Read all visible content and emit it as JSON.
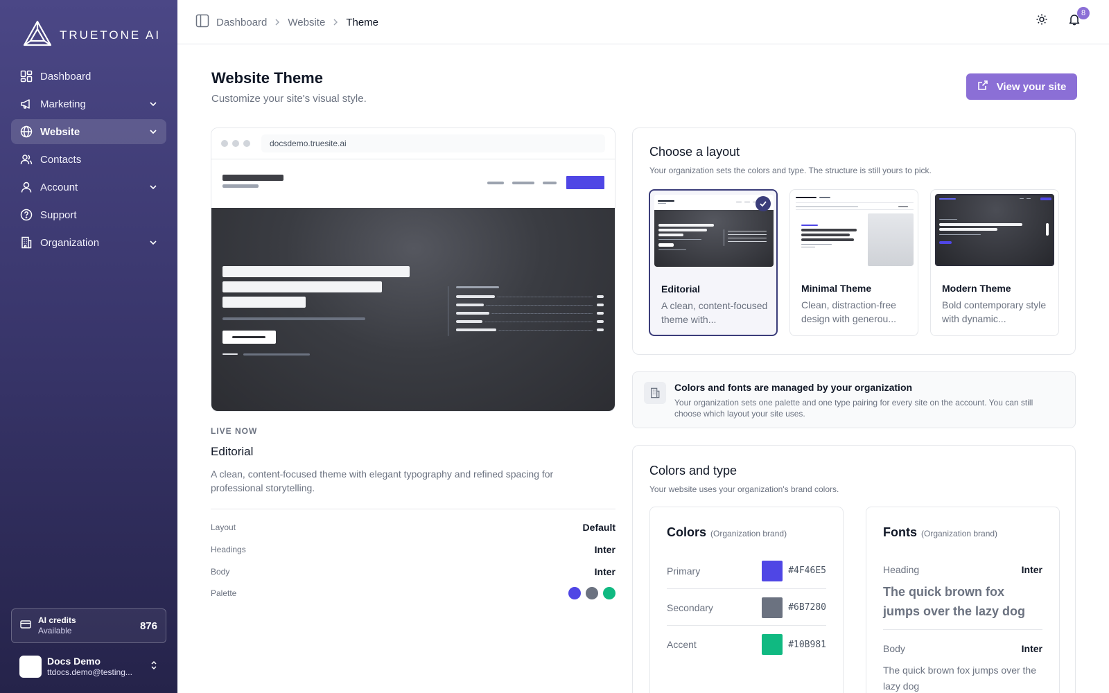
{
  "brand": {
    "name": "TRUETONE AI"
  },
  "sidebar": {
    "items": [
      {
        "label": "Dashboard",
        "icon": "grid-icon"
      },
      {
        "label": "Marketing",
        "icon": "megaphone-icon"
      },
      {
        "label": "Website",
        "icon": "globe-icon"
      },
      {
        "label": "Contacts",
        "icon": "users-icon"
      },
      {
        "label": "Account",
        "icon": "user-icon"
      },
      {
        "label": "Support",
        "icon": "help-circle-icon"
      },
      {
        "label": "Organization",
        "icon": "building-icon"
      }
    ],
    "credits": {
      "title": "AI credits",
      "status": "Available",
      "amount": "876"
    },
    "user": {
      "name": "Docs Demo",
      "email": "ttdocs.demo@testing..."
    }
  },
  "topbar": {
    "breadcrumbs": [
      "Dashboard",
      "Website",
      "Theme"
    ],
    "notifications_count": "8"
  },
  "header": {
    "title": "Website Theme",
    "subtitle": "Customize your site's visual style.",
    "view_site_label": "View your site"
  },
  "preview": {
    "url": "docsdemo.truesite.ai",
    "live_label": "LIVE NOW",
    "theme_name": "Editorial",
    "theme_description": "A clean, content-focused theme with elegant typography and refined spacing for professional storytelling.",
    "specs": [
      {
        "label": "Layout",
        "value": "Default"
      },
      {
        "label": "Headings",
        "value": "Inter"
      },
      {
        "label": "Body",
        "value": "Inter"
      },
      {
        "label": "Palette",
        "value": ""
      }
    ]
  },
  "layout_panel": {
    "title": "Choose a layout",
    "subtitle": "Your organization sets the colors and type. The structure is still yours to pick.",
    "cards": [
      {
        "title": "Editorial",
        "desc": "A clean, content-focused theme with...",
        "selected": true
      },
      {
        "title": "Minimal Theme",
        "desc": "Clean, distraction-free design with generou...",
        "selected": false
      },
      {
        "title": "Modern Theme",
        "desc": "Bold contemporary style with dynamic...",
        "selected": false
      }
    ]
  },
  "notice": {
    "title": "Colors and fonts are managed by your organization",
    "desc": "Your organization sets one palette and one type pairing for every site on the account. You can still choose which layout your site uses."
  },
  "colors_panel": {
    "title": "Colors and type",
    "subtitle": "Your website uses your organization's brand colors.",
    "colors_title": "Colors",
    "colors_note": "(Organization brand)",
    "colors": [
      {
        "label": "Primary",
        "hex": "#4F46E5"
      },
      {
        "label": "Secondary",
        "hex": "#6B7280"
      },
      {
        "label": "Accent",
        "hex": "#10B981"
      }
    ],
    "fonts_title": "Fonts",
    "fonts_note": "(Organization brand)",
    "heading_label": "Heading",
    "heading_font": "Inter",
    "heading_sample": "The quick brown fox jumps over the lazy dog",
    "body_label": "Body",
    "body_font": "Inter",
    "body_sample": "The quick brown fox jumps over the lazy dog"
  }
}
